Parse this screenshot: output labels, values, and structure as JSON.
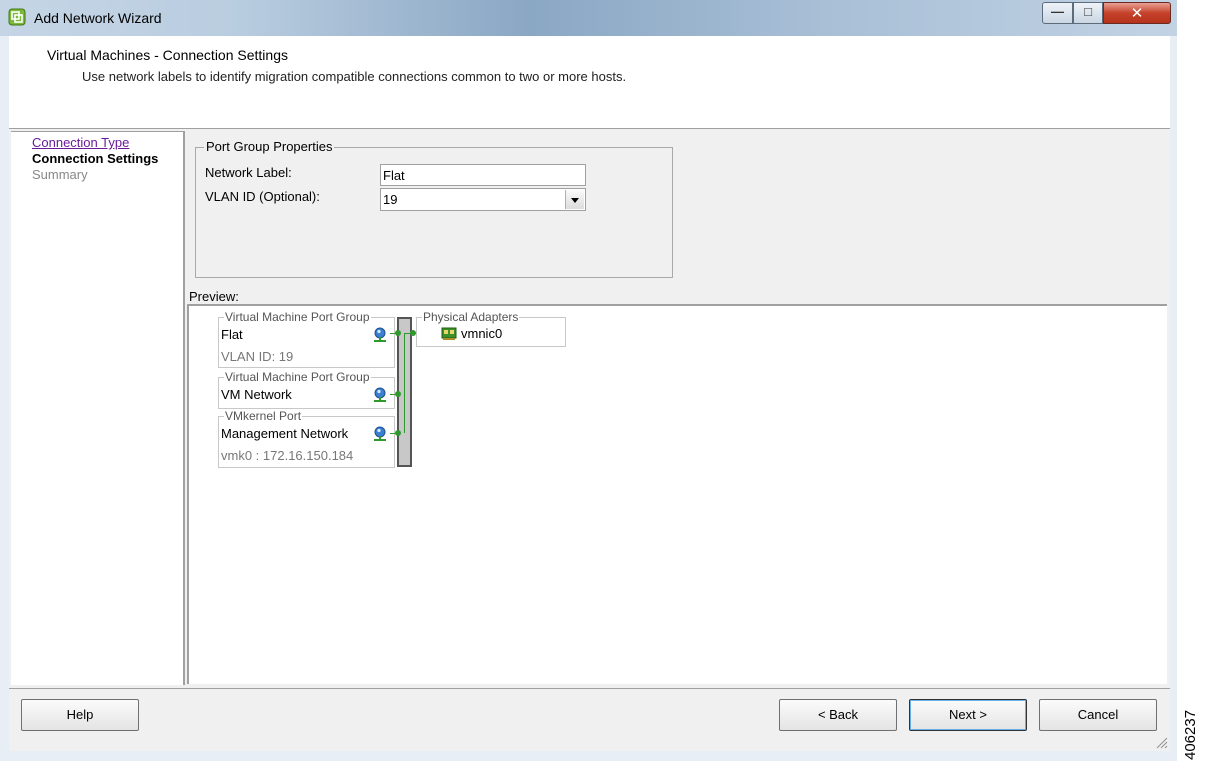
{
  "window": {
    "title": "Add Network Wizard",
    "buttons": {
      "minimize": "—",
      "maximize": "□",
      "close": "✕"
    }
  },
  "header": {
    "title": "Virtual Machines - Connection Settings",
    "subtitle": "Use network labels to identify migration compatible connections common to two or more hosts."
  },
  "nav": {
    "items": [
      {
        "label": "Connection Type",
        "state": "link"
      },
      {
        "label": "Connection Settings",
        "state": "current"
      },
      {
        "label": "Summary",
        "state": "disabled"
      }
    ]
  },
  "port_group": {
    "title": "Port Group Properties",
    "network_label_caption": "Network Label:",
    "network_label_value": "Flat",
    "vlan_caption": "VLAN ID (Optional):",
    "vlan_value": "19"
  },
  "preview": {
    "label": "Preview:",
    "groups": [
      {
        "caption": "Virtual Machine Port Group",
        "name": "Flat",
        "detail": "VLAN ID: 19"
      },
      {
        "caption": "Virtual Machine Port Group",
        "name": "VM Network",
        "detail": ""
      },
      {
        "caption": "VMkernel Port",
        "name": "Management Network",
        "detail": "vmk0 : 172.16.150.184"
      }
    ],
    "adapters": {
      "caption": "Physical Adapters",
      "items": [
        "vmnic0"
      ]
    }
  },
  "footer": {
    "help": "Help",
    "back": "< Back",
    "next": "Next >",
    "cancel": "Cancel"
  },
  "figure_id": "406237",
  "colors": {
    "link": "#6a1b9a",
    "wire": "#2e9a2e",
    "close_button": "#c6422b"
  },
  "icons": [
    "vsphere-app-icon",
    "port-group-icon",
    "physical-nic-icon",
    "dropdown-arrow-icon",
    "resize-grip-icon"
  ]
}
